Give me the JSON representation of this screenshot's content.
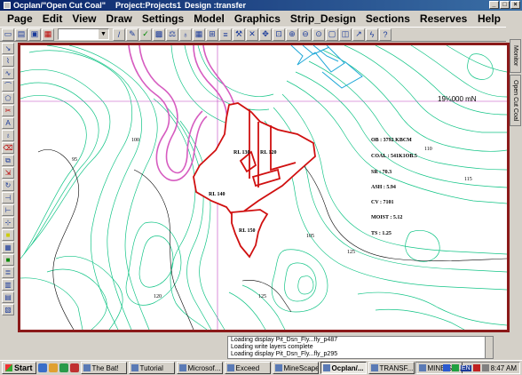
{
  "window": {
    "app_title": "Ocplan/\"Open Cut Coal\"",
    "project": "Project:Projects1",
    "design": "Design :transfer",
    "min_label": "_",
    "max_label": "□",
    "close_label": "×"
  },
  "menu": {
    "items": [
      "Page",
      "Edit",
      "View",
      "Draw",
      "Settings",
      "Model",
      "Graphics",
      "Strip_Design",
      "Sections",
      "Reserves"
    ],
    "help": "Help"
  },
  "right_tabs": {
    "monitor": "Monitor",
    "open_cut_coal": "Open Cut Coal"
  },
  "map": {
    "northing_label": "19¼000 mN",
    "contour_labels": [
      "95",
      "100",
      "110",
      "115",
      "120",
      "125",
      "105",
      "125"
    ],
    "block_labels": [
      "RL 130",
      "RL 120",
      "RL 140",
      "RL 150"
    ],
    "reserve_stats": [
      "OB : 3792 KBCM",
      "COAL : 541K1OB.5",
      "SR : 70.3",
      "ASH : 5.94",
      "CV : 7101",
      "MOIST : 5.12",
      "TS : 1.25"
    ]
  },
  "status": {
    "lines": [
      "Loading display Pit_Dsn_Fly...fly_p487",
      "Loading write layers complete",
      "Loading display Pit_Dsn_Fly...fly_p295"
    ]
  },
  "taskbar": {
    "start": "Start",
    "tasks": [
      "The Bat!",
      "Tutorial",
      "Microsof...",
      "Exceed",
      "MineScape",
      "Ocplan/...",
      "TRANSF...",
      "MINE SC..."
    ],
    "active_index": 5,
    "lang": "EN",
    "clock": "8:47 AM"
  },
  "colors": {
    "contour": "#12c486",
    "pit_outline": "#d01010",
    "haul_road": "#d65cc0",
    "river": "#1fa8d8",
    "gridline": "#c040c0",
    "frame": "#8b1a1a"
  }
}
